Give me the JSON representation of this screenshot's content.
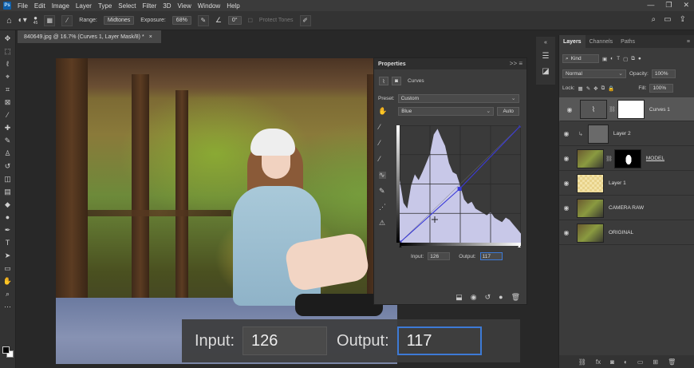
{
  "menubar": {
    "logo": "Ps",
    "items": [
      "File",
      "Edit",
      "Image",
      "Layer",
      "Type",
      "Select",
      "Filter",
      "3D",
      "View",
      "Window",
      "Help"
    ],
    "window_controls": [
      "—",
      "❐",
      "✕"
    ]
  },
  "options": {
    "brush_size": "45",
    "range_label": "Range:",
    "range_value": "Midtones",
    "exposure_label": "Exposure:",
    "exposure_value": "68%",
    "angle_value": "0°",
    "protect_tones": "Protect Tones"
  },
  "document": {
    "tab_title": "840649.jpg @ 16.7% (Curves 1, Layer Mask/8) *",
    "close": "×"
  },
  "overlay": {
    "input_label": "Input:",
    "input_value": "126",
    "output_label": "Output:",
    "output_value": "117"
  },
  "properties": {
    "tab": "Properties",
    "menu": ">> ≡",
    "adjustment_name": "Curves",
    "preset_label": "Preset:",
    "preset_value": "Custom",
    "channel_value": "Blue",
    "auto_label": "Auto",
    "input_label": "Input:",
    "input_value": "126",
    "output_label": "Output:",
    "output_value": "117"
  },
  "layers": {
    "tabs": [
      "Layers",
      "Channels",
      "Paths"
    ],
    "kind_label": "Kind",
    "blend_mode": "Normal",
    "opacity_label": "Opacity:",
    "opacity_value": "100%",
    "lock_label": "Lock:",
    "fill_label": "Fill:",
    "fill_value": "100%",
    "items": [
      {
        "name": "Curves 1"
      },
      {
        "name": "Layer 2"
      },
      {
        "name": "MODEL"
      },
      {
        "name": "Layer 1"
      },
      {
        "name": "CAMERA RAW"
      },
      {
        "name": "ORIGINAL"
      }
    ]
  },
  "colors": {
    "accent": "#3d7ad6",
    "panel": "#3c3c3c",
    "histogram": "#c8c8e8",
    "curve": "#3a3ad8"
  },
  "chart_data": {
    "type": "line",
    "channel": "Blue",
    "xlim": [
      0,
      255
    ],
    "ylim": [
      0,
      255
    ],
    "curve_points": [
      [
        0,
        0
      ],
      [
        126,
        117
      ],
      [
        255,
        255
      ]
    ]
  }
}
